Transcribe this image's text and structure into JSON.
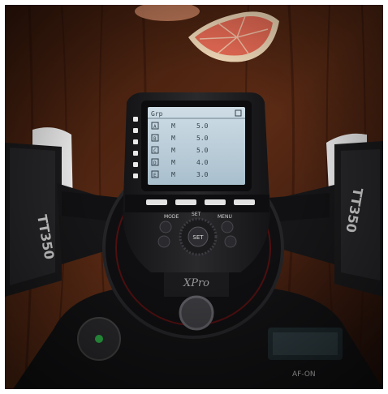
{
  "screen": {
    "header": "Grp",
    "rows": [
      {
        "group": "A",
        "mode": "M",
        "value": "5.0"
      },
      {
        "group": "B",
        "mode": "M",
        "value": "5.0"
      },
      {
        "group": "C",
        "mode": "M",
        "value": "5.0"
      },
      {
        "group": "D",
        "mode": "M",
        "value": "4.0"
      },
      {
        "group": "E",
        "mode": "M",
        "value": "3.0"
      }
    ]
  },
  "device": {
    "mode_label": "MODE",
    "set_label": "SET",
    "menu_label": "MENU",
    "center_label": "SET",
    "brand": "XPro",
    "right_flash_brand": "TT350",
    "left_flash_brand": "TT350",
    "camera_label": "AF-ON"
  },
  "colors": {
    "wood_dark": "#2b1208",
    "wood_mid": "#5a2a14",
    "lcd": "#b9cdd9",
    "body": "#1d1d1f"
  }
}
